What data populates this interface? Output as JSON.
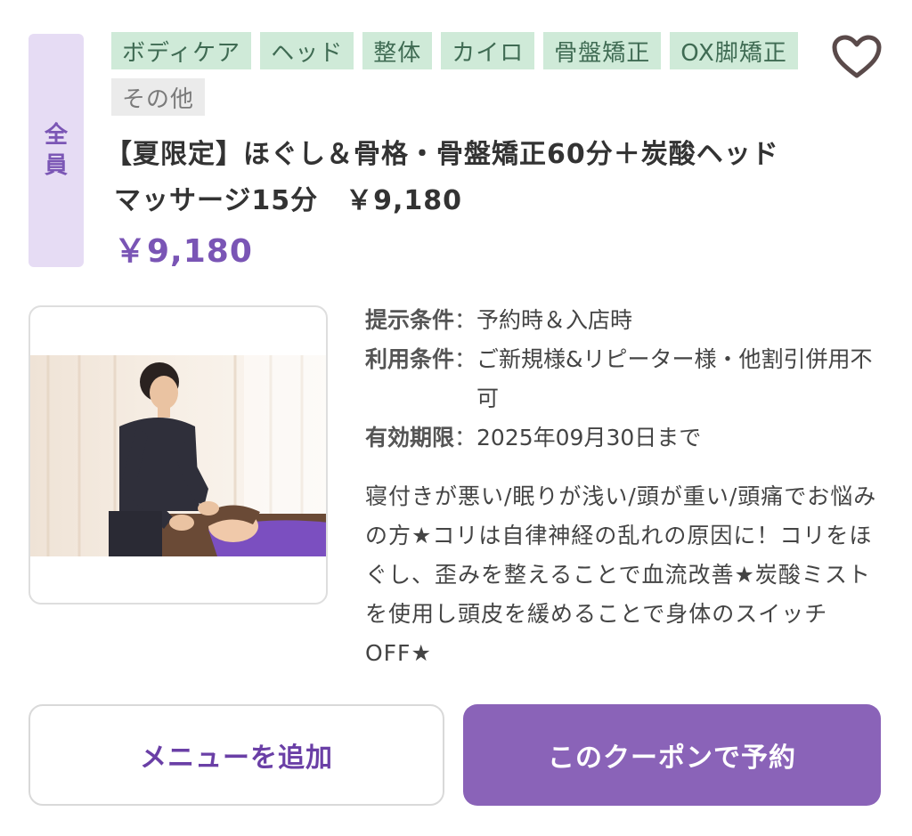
{
  "coupon": {
    "target_badge": [
      "全",
      "員"
    ],
    "tags": [
      "ボディケア",
      "ヘッド",
      "整体",
      "カイロ",
      "骨盤矯正",
      "OX脚矯正"
    ],
    "tag_other": "その他",
    "title_line1": "【夏限定】ほぐし＆骨格・骨盤矯正60分＋炭酸ヘッド",
    "title_line2": "マッサージ15分　￥9,180",
    "price": "￥9,180",
    "conditions": [
      {
        "label": "提示条件",
        "colon": "：",
        "value": "予約時＆入店時"
      },
      {
        "label": "利用条件",
        "colon": "：",
        "value": "ご新規様&リピーター様・他割引併用不可"
      },
      {
        "label": "有効期限",
        "colon": "：",
        "value": "2025年09月30日まで"
      }
    ],
    "description": "寝付きが悪い/眠りが浅い/頭が重い/頭痛でお悩みの方★コリは自律神経の乱れの原因に！コリをほぐし、歪みを整えることで血流改善★炭酸ミストを使用し頭皮を緩めることで身体のスイッチOFF★",
    "icons": {
      "favorite": "heart-outline-icon"
    }
  },
  "buttons": {
    "add_menu": "メニューを追加",
    "reserve": "このクーポンで予約"
  },
  "colors": {
    "accent": "#8a63b8",
    "price": "#7a55b5",
    "tag_bg": "#cfead8",
    "tag_text": "#3f6b53",
    "badge_bg": "#e6dcf4"
  }
}
